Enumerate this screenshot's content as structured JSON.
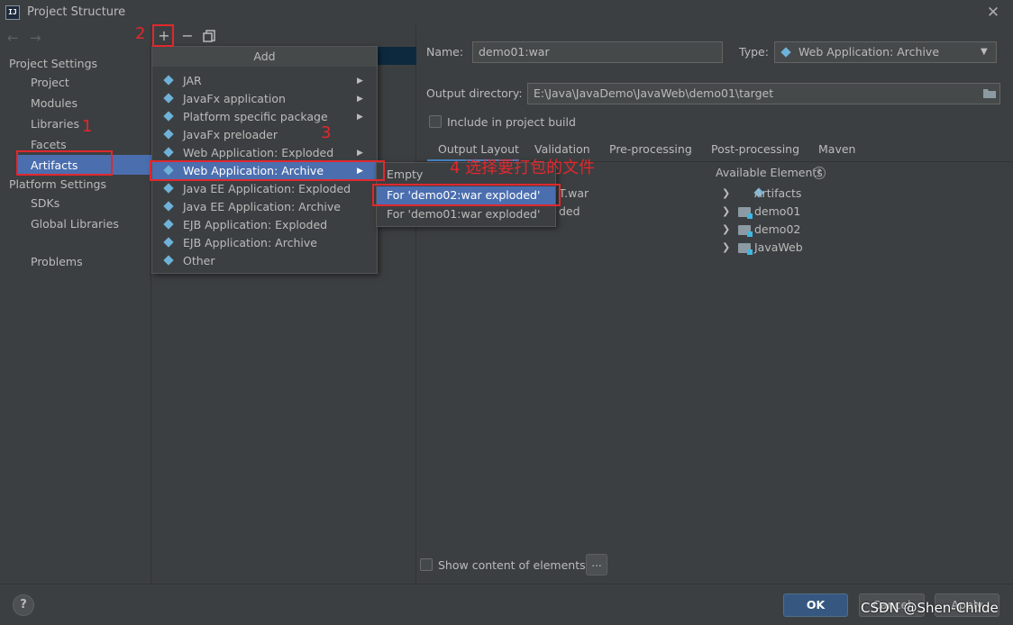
{
  "window": {
    "title": "Project Structure",
    "app_icon": "IJ"
  },
  "toolbar": {
    "add": "+",
    "remove": "−"
  },
  "sidebar": {
    "project_settings": "Project Settings",
    "items": [
      "Project",
      "Modules",
      "Libraries",
      "Facets",
      "Artifacts"
    ],
    "platform_settings": "Platform Settings",
    "platform_items": [
      "SDKs",
      "Global Libraries"
    ],
    "problems": "Problems"
  },
  "add_menu": {
    "header": "Add",
    "items": [
      {
        "label": "JAR",
        "submenu": true
      },
      {
        "label": "JavaFx application",
        "submenu": true
      },
      {
        "label": "Platform specific package",
        "submenu": true
      },
      {
        "label": "JavaFx preloader",
        "submenu": false
      },
      {
        "label": "Web Application: Exploded",
        "submenu": true
      },
      {
        "label": "Web Application: Archive",
        "submenu": true,
        "highlighted": true
      },
      {
        "label": "Java EE Application: Exploded",
        "submenu": false
      },
      {
        "label": "Java EE Application: Archive",
        "submenu": false
      },
      {
        "label": "EJB Application: Exploded",
        "submenu": false
      },
      {
        "label": "EJB Application: Archive",
        "submenu": false
      },
      {
        "label": "Other",
        "submenu": false
      }
    ]
  },
  "submenu": {
    "items": [
      "Empty",
      "For 'demo02:war exploded'",
      "For 'demo01:war exploded'"
    ],
    "highlighted_index": 1
  },
  "artifact": {
    "name_label": "Name:",
    "name_value": "demo01:war",
    "type_label": "Type:",
    "type_value": "Web Application: Archive",
    "output_label": "Output directory:",
    "output_value": "E:\\Java\\JavaDemo\\JavaWeb\\demo01\\target",
    "include_label": "Include in project build",
    "include_checked": false
  },
  "tabs": [
    "Output Layout",
    "Validation",
    "Pre-processing",
    "Post-processing",
    "Maven"
  ],
  "output_layout": {
    "partial_items": [
      "T.war",
      "ded"
    ]
  },
  "available": {
    "header": "Available Elements",
    "help": "?",
    "items": [
      "Artifacts",
      "demo01",
      "demo02",
      "JavaWeb"
    ]
  },
  "show_content": {
    "label": "Show content of elements",
    "button": "..."
  },
  "annotations": {
    "n1": "1",
    "n2": "2",
    "n3": "3",
    "n4": "4 选择要打包的文件"
  },
  "footer": {
    "help": "?",
    "ok": "OK",
    "cancel": "Cancel",
    "apply": "Apply",
    "watermark": "CSDN @Shen-Childe"
  },
  "colors": {
    "accent": "#4b6eaf",
    "annotation": "#e0282e",
    "background": "#3c3f41"
  }
}
